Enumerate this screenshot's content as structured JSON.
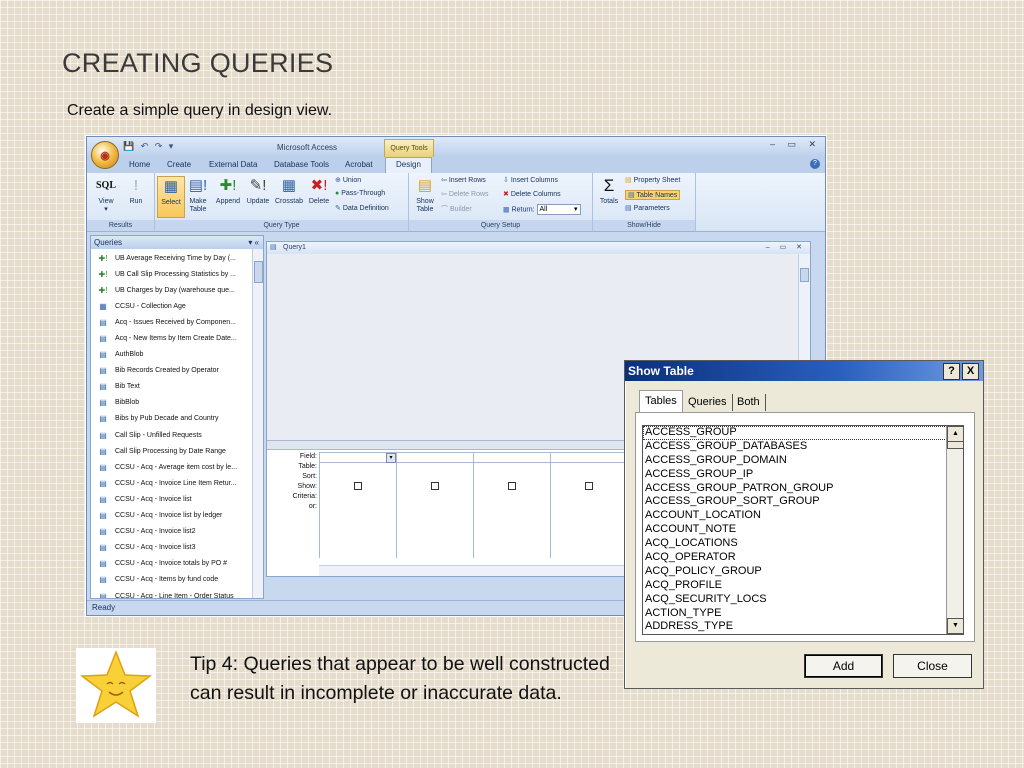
{
  "slide": {
    "title": "CREATING QUERIES",
    "subtitle": "Create a simple query  in design view.",
    "tip": "Tip 4: Queries that appear to be well constructed can result in incomplete or inaccurate data."
  },
  "access": {
    "app_title": "Microsoft Access",
    "context_tab": "Query Tools",
    "tabs": [
      "Home",
      "Create",
      "External Data",
      "Database Tools",
      "Acrobat",
      "Design"
    ],
    "ribbon": {
      "results": {
        "label": "Results",
        "view": "View",
        "run": "Run",
        "sql": "SQL"
      },
      "query_type": {
        "label": "Query Type",
        "select": "Select",
        "make_table": "Make Table",
        "append": "Append",
        "update": "Update",
        "crosstab": "Crosstab",
        "delete": "Delete",
        "union": "Union",
        "pass_through": "Pass-Through",
        "data_definition": "Data Definition"
      },
      "query_setup": {
        "label": "Query Setup",
        "show_table": "Show Table",
        "insert_rows": "Insert Rows",
        "delete_rows": "Delete Rows",
        "builder": "Builder",
        "insert_columns": "Insert Columns",
        "delete_columns": "Delete Columns",
        "return": "Return:",
        "return_value": "All"
      },
      "show_hide": {
        "label": "Show/Hide",
        "totals": "Totals",
        "property_sheet": "Property Sheet",
        "table_names": "Table Names",
        "parameters": "Parameters"
      }
    },
    "nav": {
      "header": "Queries",
      "items": [
        "UB Average Receiving Time by Day (...",
        "UB Call Slip Processing Statistics by ...",
        "UB Charges by Day (warehouse que...",
        "CCSU - Collection Age",
        "Acq - Issues Received by Componen...",
        "Acq - New Items by Item Create Date...",
        "AuthBlob",
        "Bib Records Created by Operator",
        "Bib Text",
        "BibBlob",
        "Bibs by Pub Decade and Country",
        "Call Slip - Unfilled Requests",
        "Call Slip Processing by Date Range",
        "CCSU - Acq - Average item cost by le...",
        "CCSU - Acq - Invoice Line Item Retur...",
        "CCSU - Acq - Invoice list",
        "CCSU - Acq - Invoice list by ledger",
        "CCSU - Acq - Invoice list2",
        "CCSU - Acq - Invoice list3",
        "CCSU - Acq - Invoice totals by PO #",
        "CCSU - Acq - Items by fund code",
        "CCSU - Acq - Line Item - Order Status"
      ]
    },
    "query_window": {
      "title": "Query1",
      "row_labels": [
        "Field:",
        "Table:",
        "Sort:",
        "Show:",
        "Criteria:",
        "or:"
      ]
    },
    "status": "Ready"
  },
  "dialog": {
    "title": "Show Table",
    "help": "?",
    "close_x": "X",
    "tabs": [
      "Tables",
      "Queries",
      "Both"
    ],
    "tables": [
      "ACCESS_GROUP",
      "ACCESS_GROUP_DATABASES",
      "ACCESS_GROUP_DOMAIN",
      "ACCESS_GROUP_IP",
      "ACCESS_GROUP_PATRON_GROUP",
      "ACCESS_GROUP_SORT_GROUP",
      "ACCOUNT_LOCATION",
      "ACCOUNT_NOTE",
      "ACQ_LOCATIONS",
      "ACQ_OPERATOR",
      "ACQ_POLICY_GROUP",
      "ACQ_PROFILE",
      "ACQ_SECURITY_LOCS",
      "ACTION_TYPE",
      "ADDRESS_TYPE"
    ],
    "add": "Add",
    "close": "Close"
  },
  "colors": {
    "accent": "#f7c859",
    "dialog_title": "#0b2f7a",
    "ribbon": "#d8e5f6"
  }
}
